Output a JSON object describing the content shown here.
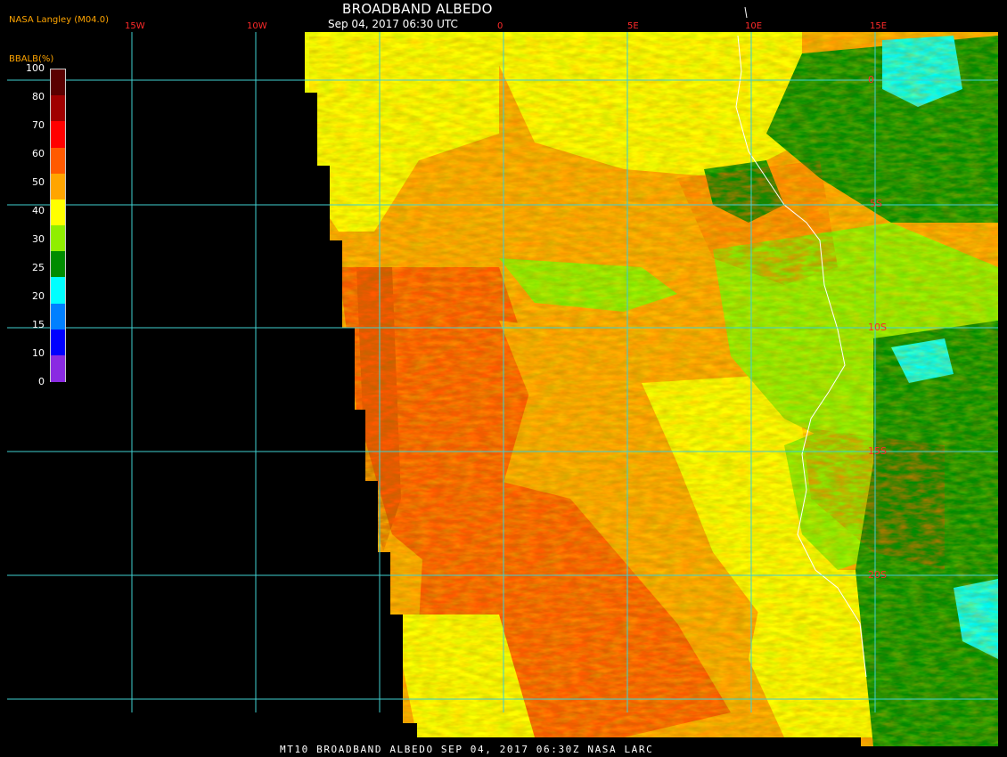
{
  "header": {
    "title": "BROADBAND ALBEDO",
    "subtitle": "Sep 04, 2017 06:30 UTC",
    "producer": "NASA Langley (M04.0)"
  },
  "footer": {
    "caption": "MT10  BROADBAND ALBEDO  SEP 04, 2017 06:30Z  NASA LARC"
  },
  "legend": {
    "title": "BBALB(%)",
    "ticks": [
      "100",
      "80",
      "70",
      "60",
      "50",
      "40",
      "30",
      "25",
      "20",
      "15",
      "10",
      "0"
    ],
    "colors": [
      "#5a0000",
      "#a00000",
      "#ff0000",
      "#ff5a00",
      "#ffa500",
      "#ffff00",
      "#90ee00",
      "#008c00",
      "#00ffff",
      "#0080ff",
      "#0000ff",
      "#8a2be2"
    ]
  },
  "map": {
    "lon_labels": [
      "15W",
      "10W",
      "0",
      "5E",
      "10E",
      "15E"
    ],
    "lat_labels": [
      "0",
      "5S",
      "10S",
      "15S",
      "20S"
    ],
    "grid_color": "#40d0d0",
    "boundary_color": "#ffffff"
  }
}
